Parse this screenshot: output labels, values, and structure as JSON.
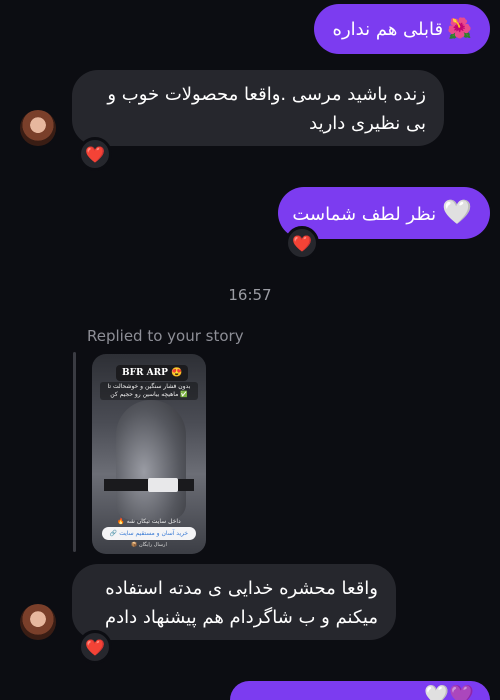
{
  "colors": {
    "background": "#0c0d12",
    "outgoing_bubble": "#7c3cf0",
    "incoming_bubble": "#26272d",
    "reaction_heart": "#ff2d55"
  },
  "messages": [
    {
      "direction": "outgoing",
      "emoji": "🌺",
      "text": "قابلی هم نداره"
    },
    {
      "direction": "incoming",
      "line1": "زنده باشید مرسی .واقعا محصولات خوب و",
      "line2": "بی نظیری دارید",
      "reaction": "❤️"
    },
    {
      "direction": "outgoing",
      "emoji": "🤍",
      "text": "نظر لطف شماست",
      "reaction": "❤️"
    },
    {
      "direction": "incoming",
      "line1": "واقعا محشره خدایی ی مدته استفاده",
      "line2": "میکنم و ب شاگردام هم پیشنهاد دادم",
      "reaction": "❤️"
    },
    {
      "direction": "outgoing",
      "emoji": "💜🤍",
      "partial": true
    }
  ],
  "timestamp": "16:57",
  "story_reply": {
    "label": "Replied to your story",
    "tag": "BFR ARP 😍",
    "caption": "بدون فشار سنگین و خوشحالت تا ماهیچه بیاسین رو حجیم کن ✅",
    "link_note": "🔥 داخل سایت تیکان شه",
    "link_text": "🔗 خرید آسان و مستقیم سایت",
    "link_sub": "📦 ارسال رایگان"
  }
}
